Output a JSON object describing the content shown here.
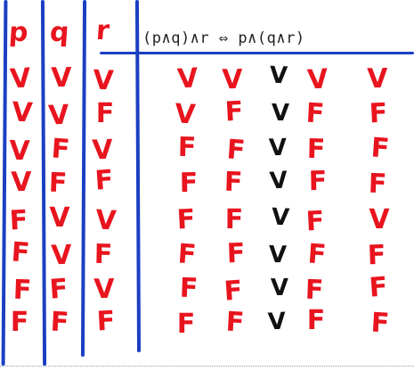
{
  "colors": {
    "true_mark": "#e8141e",
    "result_mark": "#111111",
    "rules": "#1c3fc4"
  },
  "headers": {
    "p": "p",
    "q": "q",
    "r": "r"
  },
  "formula": {
    "left": "(p∧q)∧r",
    "iff": "⇔",
    "right": "p∧(q∧r)"
  },
  "rows": [
    [
      "V",
      "V",
      "V",
      "V",
      "V",
      "V",
      "V",
      "V"
    ],
    [
      "V",
      "V",
      "F",
      "V",
      "F",
      "V",
      "F",
      "F"
    ],
    [
      "V",
      "F",
      "V",
      "F",
      "F",
      "V",
      "F",
      "F"
    ],
    [
      "V",
      "F",
      "F",
      "F",
      "F",
      "V",
      "F",
      "F"
    ],
    [
      "F",
      "V",
      "V",
      "F",
      "F",
      "V",
      "F",
      "V"
    ],
    [
      "F",
      "V",
      "F",
      "F",
      "F",
      "V",
      "F",
      "F"
    ],
    [
      "F",
      "F",
      "V",
      "F",
      "F",
      "V",
      "F",
      "F"
    ],
    [
      "F",
      "F",
      "F",
      "F",
      "F",
      "V",
      "F",
      "F"
    ]
  ]
}
